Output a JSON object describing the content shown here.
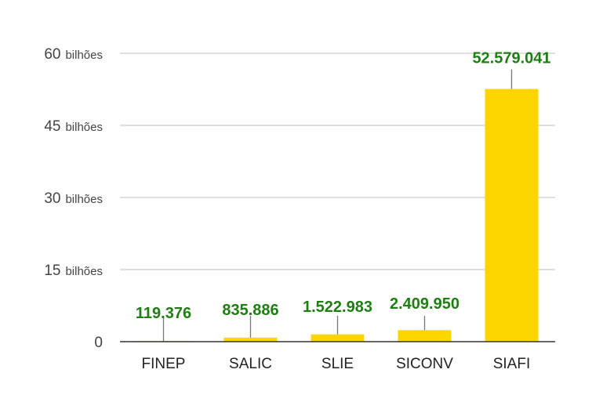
{
  "chart_data": {
    "type": "bar",
    "categories": [
      "FINEP",
      "SALIC",
      "SLIE",
      "SICONV",
      "SIAFI"
    ],
    "values": [
      119376,
      835886,
      1522983,
      2409950,
      52579041
    ],
    "value_units": "thousands",
    "data_labels": [
      "119.376",
      "835.886",
      "1.522.983",
      "2.409.950",
      "52.579.041"
    ],
    "ylim": [
      0,
      60000000
    ],
    "yticks": [
      {
        "value": 0,
        "num": "0",
        "unit": ""
      },
      {
        "value": 15000000,
        "num": "15",
        "unit": "bilhões"
      },
      {
        "value": 30000000,
        "num": "30",
        "unit": "bilhões"
      },
      {
        "value": 45000000,
        "num": "45",
        "unit": "bilhões"
      },
      {
        "value": 60000000,
        "num": "60",
        "unit": "bilhões"
      }
    ],
    "grid": true,
    "title": "",
    "xlabel": "",
    "ylabel": ""
  },
  "colors": {
    "bar": "#FDD600",
    "label": "#1E7E12",
    "grid": "#CCCCCC",
    "axis": "#333333",
    "leader": "#777777"
  }
}
